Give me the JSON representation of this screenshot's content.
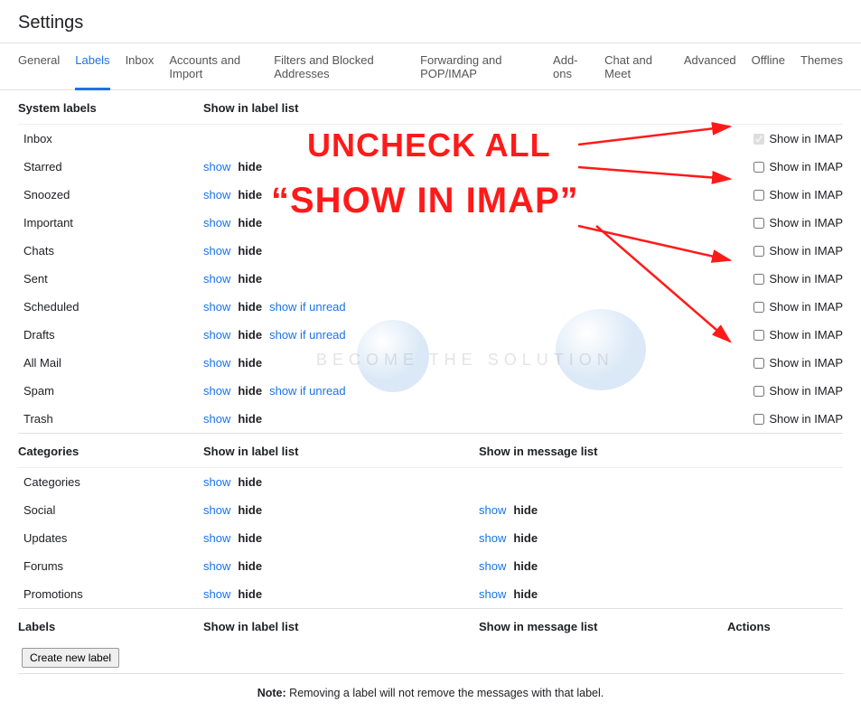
{
  "title": "Settings",
  "tabs": [
    "General",
    "Labels",
    "Inbox",
    "Accounts and Import",
    "Filters and Blocked Addresses",
    "Forwarding and POP/IMAP",
    "Add-ons",
    "Chat and Meet",
    "Advanced",
    "Offline",
    "Themes"
  ],
  "activeTabIndex": 1,
  "headers": {
    "system": "System labels",
    "labellist": "Show in label list",
    "categories": "Categories",
    "msglist": "Show in message list",
    "labels": "Labels",
    "actions": "Actions"
  },
  "links": {
    "show": "show",
    "hide": "hide",
    "unread": "show if unread"
  },
  "imapLabel": "Show in IMAP",
  "systemLabels": [
    {
      "name": "Inbox",
      "showHide": false,
      "unread": false,
      "imap": "disabled"
    },
    {
      "name": "Starred",
      "showHide": true,
      "unread": false,
      "imap": "unchecked"
    },
    {
      "name": "Snoozed",
      "showHide": true,
      "unread": false,
      "imap": "unchecked"
    },
    {
      "name": "Important",
      "showHide": true,
      "unread": false,
      "imap": "unchecked"
    },
    {
      "name": "Chats",
      "showHide": true,
      "unread": false,
      "imap": "unchecked"
    },
    {
      "name": "Sent",
      "showHide": true,
      "unread": false,
      "imap": "unchecked"
    },
    {
      "name": "Scheduled",
      "showHide": true,
      "unread": true,
      "imap": "unchecked"
    },
    {
      "name": "Drafts",
      "showHide": true,
      "unread": true,
      "imap": "unchecked"
    },
    {
      "name": "All Mail",
      "showHide": true,
      "unread": false,
      "imap": "unchecked"
    },
    {
      "name": "Spam",
      "showHide": true,
      "unread": true,
      "imap": "unchecked"
    },
    {
      "name": "Trash",
      "showHide": true,
      "unread": false,
      "imap": "unchecked"
    }
  ],
  "categories": [
    {
      "name": "Categories",
      "msgList": false
    },
    {
      "name": "Social",
      "msgList": true
    },
    {
      "name": "Updates",
      "msgList": true
    },
    {
      "name": "Forums",
      "msgList": true
    },
    {
      "name": "Promotions",
      "msgList": true
    }
  ],
  "createLabel": "Create new label",
  "note": {
    "bold": "Note:",
    "text": " Removing a label will not remove the messages with that label."
  },
  "annotation": {
    "line1": "UNCHECK ALL",
    "line2": "“SHOW IN IMAP”"
  },
  "watermark": "BECOME THE SOLUTION"
}
